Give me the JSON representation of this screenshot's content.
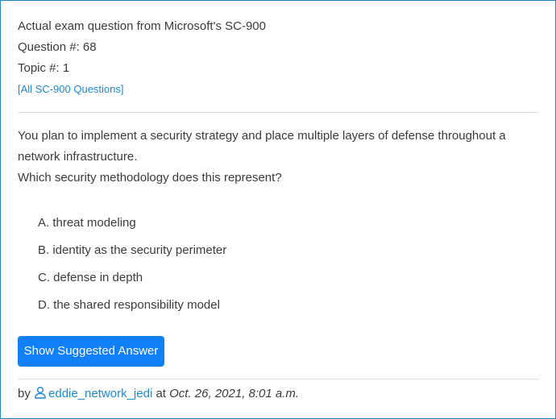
{
  "header": {
    "line1": "Actual exam question from Microsoft's SC-900",
    "question_number": "Question #: 68",
    "topic": "Topic #: 1",
    "all_questions_link": "[All SC-900 Questions]"
  },
  "question": {
    "text_line1": "You plan to implement a security strategy and place multiple layers of defense throughout a network infrastructure.",
    "text_line2": "Which security methodology does this represent?"
  },
  "choices": [
    {
      "label": "A. threat modeling"
    },
    {
      "label": "B. identity as the security perimeter"
    },
    {
      "label": "C. defense in depth"
    },
    {
      "label": "D. the shared responsibility model"
    }
  ],
  "show_answer_button": "Show Suggested Answer",
  "footer": {
    "by": "by",
    "username": "eddie_network_jedi",
    "at": "at",
    "date": "Oct. 26, 2021, 8:01 a.m."
  },
  "colors": {
    "accent": "#117ff5",
    "link": "#1a8ad3",
    "border": "#1f87c7"
  }
}
